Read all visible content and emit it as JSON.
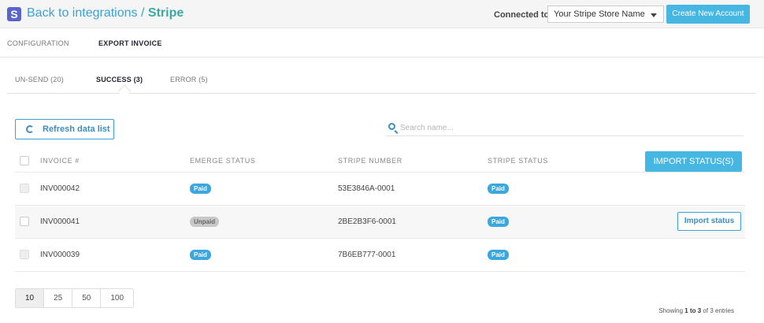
{
  "header": {
    "logo_letter": "S",
    "back_link": "Back to integrations",
    "separator": "/",
    "current": "Stripe",
    "connected_label": "Connected to:",
    "store_select_value": "Your Stripe Store Name",
    "create_button": "Create New Account"
  },
  "main_tabs": [
    "CONFIGURATION",
    "EXPORT INVOICE"
  ],
  "sub_tabs": [
    "UN-SEND (20)",
    "SUCCESS (3)",
    "ERROR (5)"
  ],
  "toolbar": {
    "refresh_label": "Refresh data list",
    "search_placeholder": "Search name..."
  },
  "table": {
    "columns": [
      "INVOICE #",
      "EMERGE STATUS",
      "STRIPE NUMBER",
      "STRIPE STATUS"
    ],
    "import_all_button": "IMPORT STATUS(S)",
    "import_row_button": "Import status",
    "rows": [
      {
        "invoice": "INV000042",
        "emerge_status": "Paid",
        "stripe_number": "53E3846A-0001",
        "stripe_status": "Paid"
      },
      {
        "invoice": "INV000041",
        "emerge_status": "Unpaid",
        "stripe_number": "2BE2B3F6-0001",
        "stripe_status": "Paid"
      },
      {
        "invoice": "INV000039",
        "emerge_status": "Paid",
        "stripe_number": "7B6EB777-0001",
        "stripe_status": "Paid"
      }
    ]
  },
  "pagination": {
    "page_sizes": [
      "10",
      "25",
      "50",
      "100"
    ],
    "showing_prefix": "Showing",
    "range_start": "1",
    "range_to": "to",
    "range_end": "3",
    "showing_suffix": "of 3 entries"
  },
  "colors": {
    "accent": "#45b7e2",
    "link": "#3da2d3",
    "stripe_title": "#3aa9a4",
    "paid_badge": "#3aa7de",
    "unpaid_badge": "#c8c8c8"
  },
  "icons": [
    "stripe-logo-icon",
    "chevron-down-icon",
    "refresh-icon",
    "search-icon"
  ]
}
